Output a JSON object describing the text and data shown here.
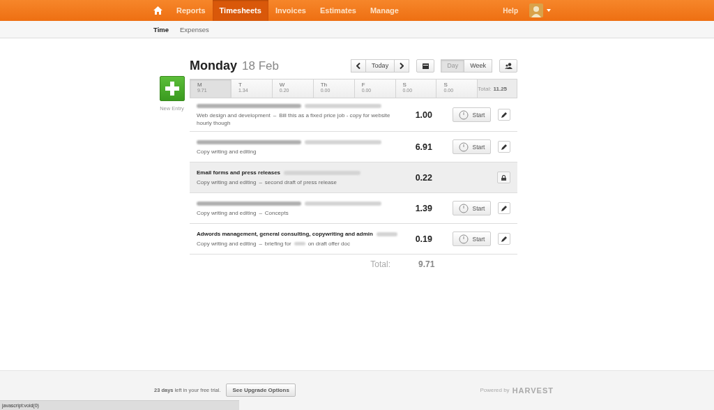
{
  "nav": {
    "items": [
      {
        "kind": "home",
        "selected": false
      },
      {
        "label": "Reports",
        "selected": false
      },
      {
        "label": "Timesheets",
        "selected": true
      },
      {
        "label": "Invoices",
        "selected": false
      },
      {
        "label": "Estimates",
        "selected": false
      },
      {
        "label": "Manage",
        "selected": false
      }
    ],
    "help": "Help"
  },
  "subnav": [
    {
      "label": "Time",
      "selected": true
    },
    {
      "label": "Expenses",
      "selected": false
    }
  ],
  "new_entry": {
    "label": "New Entry"
  },
  "heading": {
    "day": "Monday",
    "date": "18 Feb"
  },
  "toolbar": {
    "today": "Today",
    "views": [
      {
        "label": "Day",
        "selected": true
      },
      {
        "label": "Week",
        "selected": false
      }
    ]
  },
  "week": {
    "days": [
      {
        "name": "M",
        "hours": "9.71",
        "selected": true
      },
      {
        "name": "T",
        "hours": "1.34",
        "selected": false
      },
      {
        "name": "W",
        "hours": "0.20",
        "selected": false
      },
      {
        "name": "Th",
        "hours": "0.00",
        "selected": false
      },
      {
        "name": "F",
        "hours": "0.00",
        "selected": false
      },
      {
        "name": "S",
        "hours": "0.00",
        "selected": false
      },
      {
        "name": "S",
        "hours": "0.00",
        "selected": false
      }
    ],
    "total_label": "Total:",
    "total": "11.25"
  },
  "entries": [
    {
      "title_redacted": true,
      "client_redacted": true,
      "task": "Web design and development",
      "separator": "–",
      "notes": [
        "Bill this as a fixed price job - copy for website hourly though"
      ],
      "hours": "1.00",
      "locked": false,
      "start": "Start"
    },
    {
      "title_redacted": true,
      "client_redacted": true,
      "task": "Copy writing and editing",
      "hours": "6.91",
      "locked": false,
      "start": "Start"
    },
    {
      "title": "Email forms and press releases",
      "client_redacted": true,
      "task": "Copy writing and editing",
      "separator": "–",
      "notes": [
        "second draft of press release"
      ],
      "hours": "0.22",
      "locked": true
    },
    {
      "title_redacted": true,
      "client_redacted": true,
      "task": "Copy writing and editing",
      "separator": "–",
      "notes": [
        "Concepts"
      ],
      "hours": "1.39",
      "locked": false,
      "start": "Start"
    },
    {
      "title": "Adwords management, general consulting, copywriting and admin",
      "client_redacted": true,
      "task": "Copy writing and editing",
      "separator": "–",
      "notes": [
        "briefing for",
        "on draft offer doc"
      ],
      "hours": "0.19",
      "locked": false,
      "start": "Start"
    }
  ],
  "total": {
    "label": "Total:",
    "value": "9.71"
  },
  "footer": {
    "days": "23 days",
    "trial": "left in your free trial.",
    "upgrade": "See Upgrade Options",
    "powered": "Powered by",
    "brand": "HARVEST"
  },
  "status_bar": "javascript:void(0)"
}
